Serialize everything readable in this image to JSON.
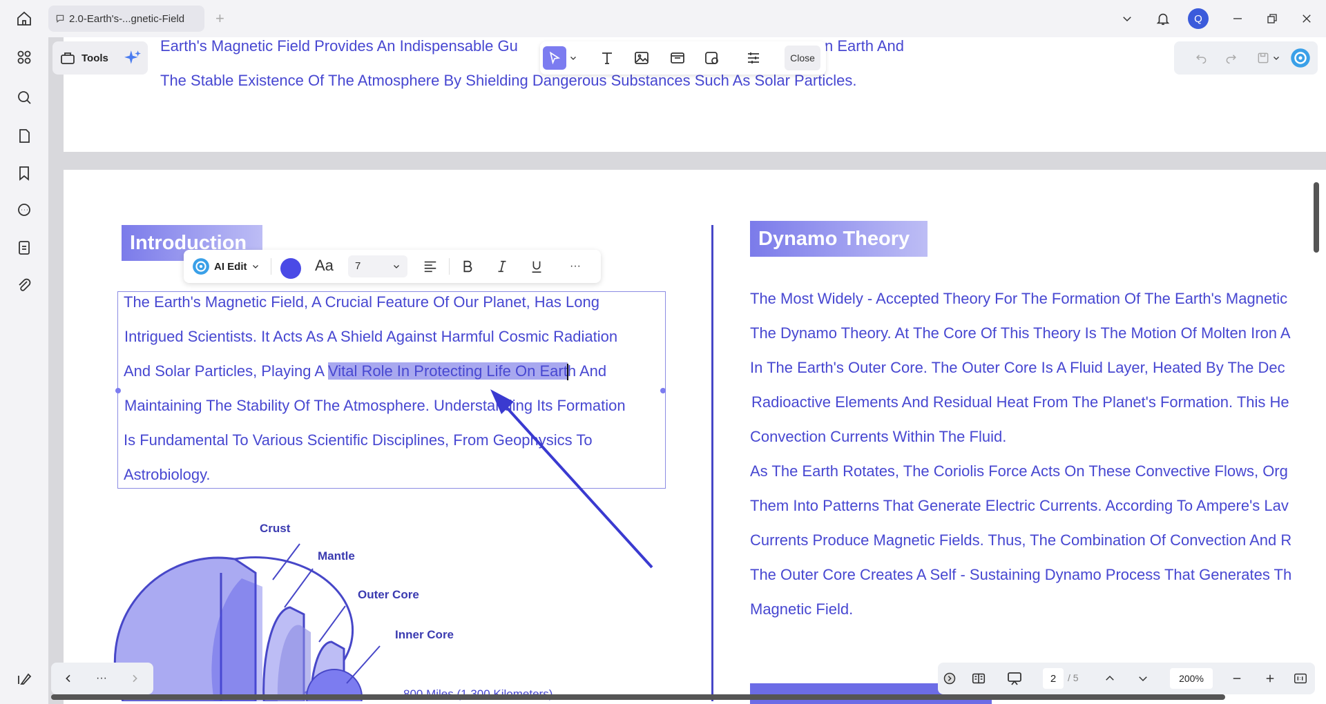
{
  "tab": {
    "title": "2.0-Earth's-...gnetic-Field"
  },
  "avatar_letter": "Q",
  "tools_label": "Tools",
  "edit_toolbar": {
    "close_label": "Close"
  },
  "page1_lines": [
    "Earth's Magnetic Field Provides An Indispensable Gu",
    "n Earth And",
    "The Stable Existence Of The Atmosphere By Shielding Dangerous Substances Such As Solar Particles."
  ],
  "introduction": {
    "heading": "Introduction",
    "line1": "The Earth's Magnetic Field, A Crucial Feature Of Our Planet, Has Long",
    "line2": "Intrigued Scientists. It Acts As A Shield Against Harmful Cosmic Radiation",
    "line3_pre": "And Solar Particles, Playing A ",
    "line3_hl": "Vital Role In Protecting Life On Eart",
    "line3_post": "h And",
    "line4": "Maintaining The Stability Of The Atmosphere. Understanding Its Formation",
    "line5": "Is Fundamental To Various Scientific Disciplines, From Geophysics To",
    "line6": "Astrobiology."
  },
  "float_toolbar": {
    "ai_label": "AI Edit",
    "font_size": "7",
    "more": "···",
    "text_color": "#4a4ae6"
  },
  "dynamo": {
    "heading": "Dynamo Theory",
    "lines": [
      "The Most Widely - Accepted Theory For The Formation Of The Earth's Magnetic",
      "The Dynamo Theory. At The Core Of This Theory Is The Motion Of Molten Iron A",
      "In The Earth's Outer Core. The Outer Core Is A Fluid Layer, Heated By The Dec",
      "Radioactive Elements And Residual Heat From The Planet's Formation. This He",
      "Convection Currents Within The Fluid.",
      "As The Earth Rotates, The Coriolis Force Acts On These Convective Flows, Org",
      "Them Into Patterns That Generate Electric Currents. According To Ampere's Lav",
      "Currents Produce Magnetic Fields. Thus, The Combination Of Convection And R",
      "The Outer Core Creates A Self - Sustaining Dynamo Process That Generates Th",
      "Magnetic Field."
    ]
  },
  "globe_labels": {
    "crust": "Crust",
    "mantle": "Mantle",
    "outer_core": "Outer Core",
    "inner_core": "Inner Core"
  },
  "bottom_caption": "800 Miles (1,300 Kilometers)",
  "nav": {
    "more": "···",
    "current_page": "2",
    "total_pages": "/ 5",
    "zoom": "200%"
  },
  "colors": {
    "accent": "#4747d1",
    "heading_bg": "#7b7bea"
  }
}
